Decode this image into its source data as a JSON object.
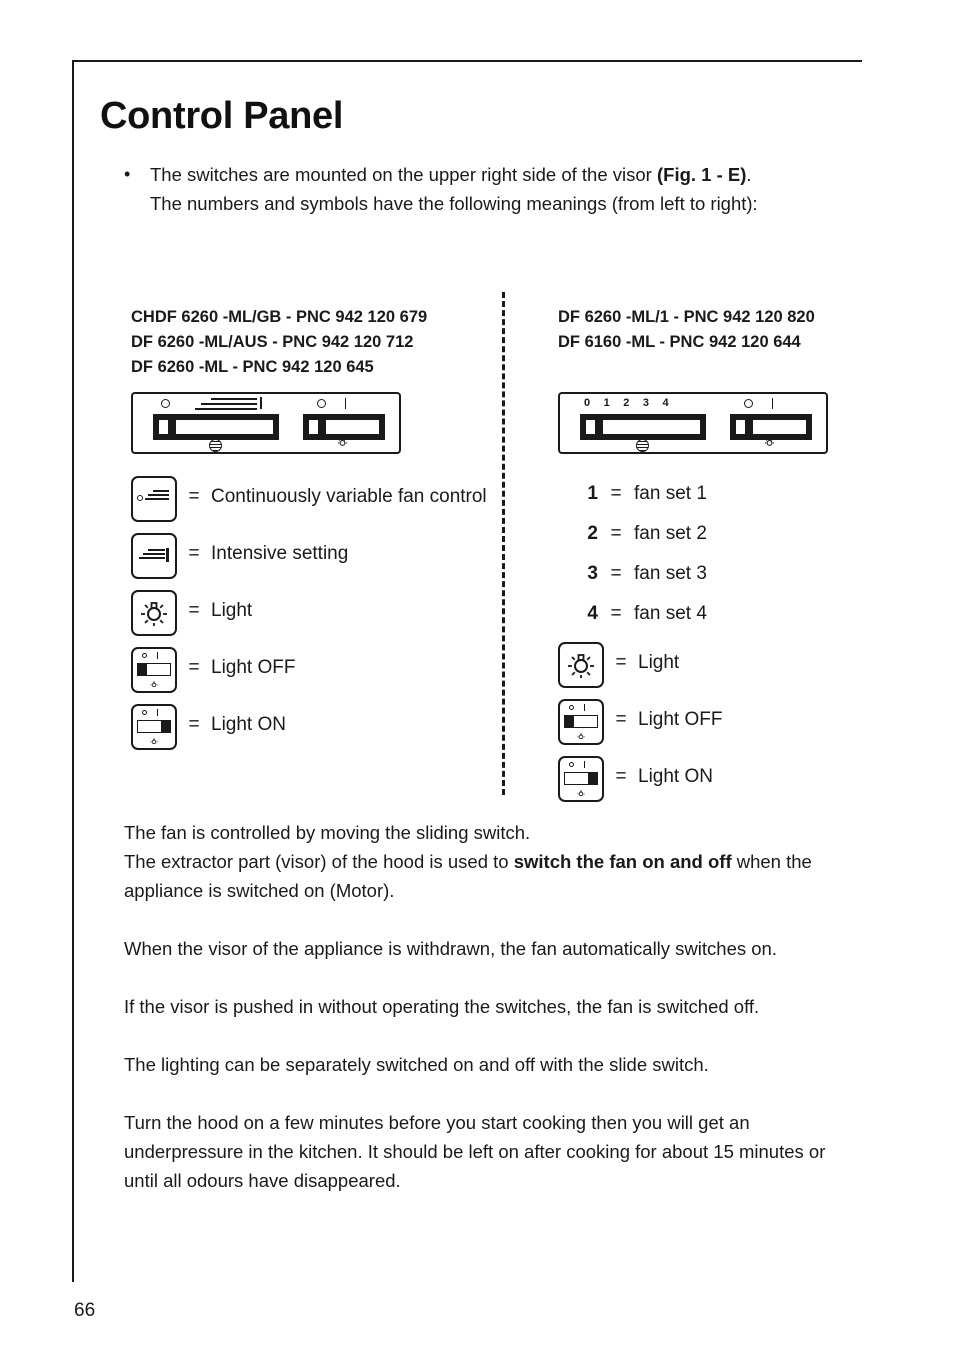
{
  "document": {
    "title": "Control Panel",
    "page_number": "66"
  },
  "intro": {
    "bullet": "•",
    "line1_a": "The switches are mounted on the upper right side of the visor ",
    "line1_b": "(Fig. 1 - E)",
    "line1_c": ".",
    "line2": "The numbers and symbols have the following meanings (from left to right):"
  },
  "left_column": {
    "models": [
      "CHDF 6260 -ML/GB - PNC 942 120 679",
      "DF 6260 -ML/AUS - PNC 942 120 712",
      "DF 6260 -ML - PNC 942 120 645"
    ],
    "panel": {
      "fan_scale": "",
      "light_scale_o": "O",
      "light_scale_i": "I"
    },
    "legend": [
      {
        "icon": "variable-fan-icon",
        "eq": "=",
        "label": "Continuously variable fan control"
      },
      {
        "icon": "intensive-setting-icon",
        "eq": "=",
        "label": "Intensive setting"
      },
      {
        "icon": "light-bulb-icon",
        "eq": "=",
        "label": "Light"
      },
      {
        "icon": "light-off-switch-icon",
        "eq": "=",
        "label": "Light OFF"
      },
      {
        "icon": "light-on-switch-icon",
        "eq": "=",
        "label": "Light ON"
      }
    ]
  },
  "right_column": {
    "models": [
      "DF 6260 -ML/1 - PNC 942 120 820",
      "DF 6160 -ML - PNC 942 120 644"
    ],
    "panel": {
      "fan_scale": [
        "0",
        "1",
        "2",
        "3",
        "4"
      ],
      "light_scale_o": "O",
      "light_scale_i": "I"
    },
    "fan_settings": [
      {
        "num": "1",
        "eq": "=",
        "label": "fan set 1"
      },
      {
        "num": "2",
        "eq": "=",
        "label": "fan set  2"
      },
      {
        "num": "3",
        "eq": "=",
        "label": "fan set 3"
      },
      {
        "num": "4",
        "eq": "=",
        "label": "fan set  4"
      }
    ],
    "legend": [
      {
        "icon": "light-bulb-icon",
        "eq": "=",
        "label": "Light"
      },
      {
        "icon": "light-off-switch-icon",
        "eq": "=",
        "label": "Light OFF"
      },
      {
        "icon": "light-on-switch-icon",
        "eq": "=",
        "label": "Light ON"
      }
    ]
  },
  "body": {
    "p1_a": "The fan is controlled by moving the sliding switch.",
    "p1_b": "The extractor part (visor) of the hood is used to ",
    "p1_bold": "switch the fan on and off",
    "p1_c": " when the appliance is switched on (Motor).",
    "p2": "When the visor of the appliance is withdrawn, the fan automatically switches on.",
    "p3": "If the visor is pushed in without operating the switches, the fan is switched off.",
    "p4": "The lighting can be separately switched on and off with the slide switch.",
    "p5": "Turn the hood on a few minutes before you start cooking then you will get an underpressure in the kitchen. It should be left on after cooking for about 15 minutes or until all odours have disappeared."
  },
  "colors": {
    "ink": "#1a1a1a",
    "paper": "#ffffff"
  }
}
